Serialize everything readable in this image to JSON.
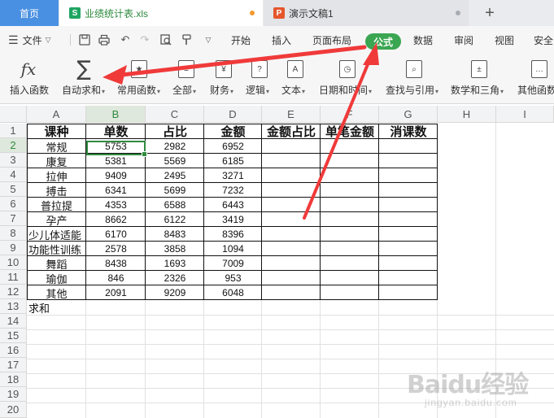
{
  "tabs": {
    "home": "首页",
    "file1": "业绩统计表.xls",
    "file2": "演示文稿1",
    "new_tab": "+"
  },
  "menu": {
    "file": "文件",
    "items": [
      "开始",
      "插入",
      "页面布局",
      "公式",
      "数据",
      "审阅",
      "视图",
      "安全"
    ],
    "active": "公式"
  },
  "ribbon": {
    "insert_function": "插入函数",
    "autosum": "自动求和",
    "common_functions": "常用函数",
    "all": "全部",
    "finance": "财务",
    "logic": "逻辑",
    "text": "文本",
    "datetime": "日期和时间",
    "lookup": "查找与引用",
    "math": "数学和三角",
    "other": "其他函数"
  },
  "columns": [
    "A",
    "B",
    "C",
    "D",
    "E",
    "F",
    "G",
    "H",
    "I"
  ],
  "rows": [
    "1",
    "2",
    "3",
    "4",
    "5",
    "6",
    "7",
    "8",
    "9",
    "10",
    "11",
    "12",
    "13",
    "14",
    "15",
    "16",
    "17",
    "18",
    "19",
    "20"
  ],
  "table": {
    "headers": [
      "课种",
      "单数",
      "占比",
      "金额",
      "金额占比",
      "单笔金额",
      "消课数"
    ],
    "data": [
      [
        "常规",
        "5753",
        "2982",
        "6952"
      ],
      [
        "康复",
        "5381",
        "5569",
        "6185"
      ],
      [
        "拉伸",
        "9409",
        "2495",
        "3271"
      ],
      [
        "搏击",
        "6341",
        "5699",
        "7232"
      ],
      [
        "普拉提",
        "4353",
        "6588",
        "6443"
      ],
      [
        "孕产",
        "8662",
        "6122",
        "3419"
      ],
      [
        "少儿体适能",
        "6170",
        "8483",
        "8396"
      ],
      [
        "功能性训练",
        "2578",
        "3858",
        "1094"
      ],
      [
        "舞蹈",
        "8438",
        "1693",
        "7009"
      ],
      [
        "瑜伽",
        "846",
        "2326",
        "953"
      ],
      [
        "其他",
        "2091",
        "9209",
        "6048"
      ]
    ],
    "footer": "求和"
  },
  "selection": {
    "cell": "B2",
    "column": "B",
    "row": "2"
  },
  "colors": {
    "accent": "#3aa651",
    "arrow": "#f03a3a",
    "home_tab": "#4a90e2"
  },
  "watermark": {
    "main": "Baidu经验",
    "sub": "jingyan.baidu.com"
  }
}
